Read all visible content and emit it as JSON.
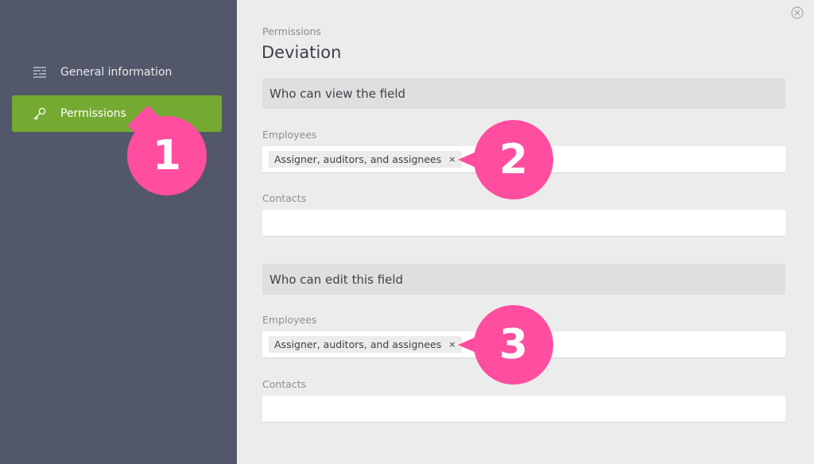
{
  "sidebar": {
    "items": [
      {
        "label": "General information",
        "icon": "list-lines-icon",
        "active": false
      },
      {
        "label": "Permissions",
        "icon": "key-icon",
        "active": true
      }
    ]
  },
  "main": {
    "breadcrumb": "Permissions",
    "title": "Deviation",
    "sections": [
      {
        "header": "Who can view the field",
        "employees_label": "Employees",
        "employees_tag": "Assigner, auditors, and assignees",
        "contacts_label": "Contacts"
      },
      {
        "header": "Who can edit this field",
        "employees_label": "Employees",
        "employees_tag": "Assigner, auditors, and assignees",
        "contacts_label": "Contacts"
      }
    ],
    "tag_remove": "×"
  },
  "callouts": [
    "1",
    "2",
    "3"
  ],
  "colors": {
    "sidebar_bg": "#525869",
    "active_item": "#74aa31",
    "badge": "#ff4da0",
    "main_bg": "#ececec"
  }
}
